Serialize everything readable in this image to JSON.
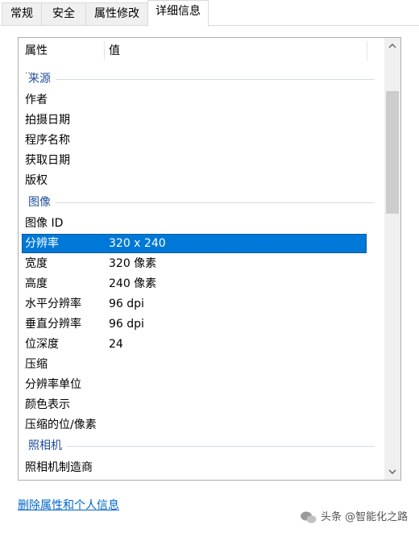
{
  "tabs": [
    {
      "label": "常规"
    },
    {
      "label": "安全"
    },
    {
      "label": "属性修改"
    },
    {
      "label": "详细信息"
    }
  ],
  "list": {
    "header": {
      "property": "属性",
      "value": "值"
    },
    "partial_top": "…",
    "groups": {
      "source": "来源",
      "image": "图像",
      "camera": "照相机"
    },
    "rows": [
      {
        "key": "作者",
        "value": ""
      },
      {
        "key": "拍摄日期",
        "value": ""
      },
      {
        "key": "程序名称",
        "value": ""
      },
      {
        "key": "获取日期",
        "value": ""
      },
      {
        "key": "版权",
        "value": ""
      },
      {
        "key": "图像 ID",
        "value": ""
      },
      {
        "key": "分辨率",
        "value": "320 x 240"
      },
      {
        "key": "宽度",
        "value": "320 像素"
      },
      {
        "key": "高度",
        "value": "240 像素"
      },
      {
        "key": "水平分辨率",
        "value": "96 dpi"
      },
      {
        "key": "垂直分辨率",
        "value": "96 dpi"
      },
      {
        "key": "位深度",
        "value": "24"
      },
      {
        "key": "压缩",
        "value": ""
      },
      {
        "key": "分辨率单位",
        "value": ""
      },
      {
        "key": "颜色表示",
        "value": ""
      },
      {
        "key": "压缩的位/像素",
        "value": ""
      },
      {
        "key": "照相机制造商",
        "value": ""
      }
    ],
    "selected_key": "分辨率"
  },
  "footer": {
    "remove_link": "删除属性和个人信息"
  },
  "watermark": {
    "text": "头条 @智能化之路"
  },
  "icons": {
    "scroll_up": "chevron-up-icon",
    "scroll_down": "chevron-down-icon",
    "watermark": "wechat-bubbles-icon"
  },
  "colors": {
    "selection": "#0078d7",
    "group_text": "#1f4e99",
    "link": "#0066cc"
  }
}
